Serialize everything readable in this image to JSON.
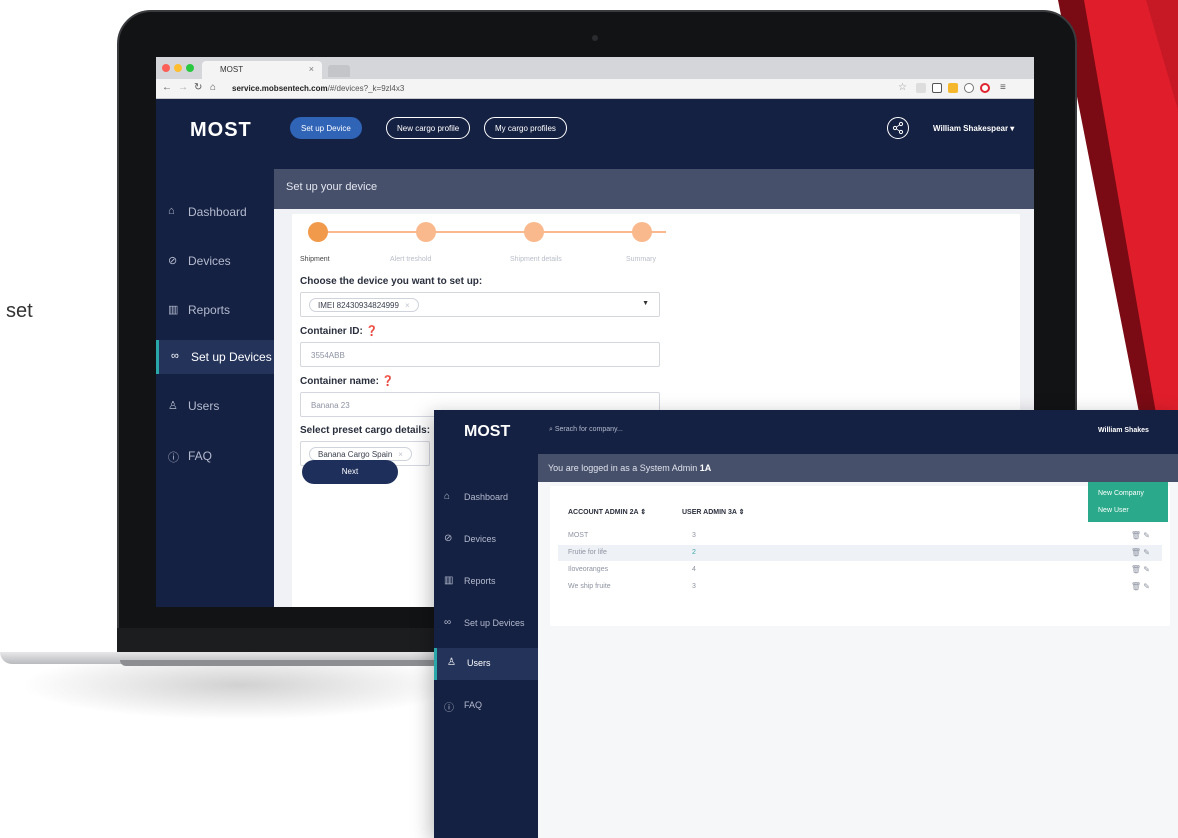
{
  "stray_text": "set",
  "browser": {
    "tab_title": "MOST",
    "tab_close": "×",
    "url_host": "service.mobsentech.com",
    "url_path": "/#/devices?_k=9zl4x3"
  },
  "app": {
    "logo": "MOST",
    "top_buttons": [
      "Set up Device",
      "New cargo profile",
      "My cargo profiles"
    ],
    "user_menu": "William Shakespear ▾",
    "sidebar": [
      "Dashboard",
      "Devices",
      "Reports",
      "Set up Devices",
      "Users",
      "FAQ"
    ],
    "active_sidebar": "Set up Devices",
    "page_title": "Set up your device",
    "steps": [
      "Shipment",
      "Alert treshold",
      "Shipment details",
      "Summary"
    ],
    "device_label": "Choose the device you want to set up:",
    "device_chip": "IMEI 82430934824999",
    "container_id_label": "Container ID:",
    "container_id_value": "3554ABB",
    "container_name_label": "Container name:",
    "container_name_value": "Banana 23",
    "preset_label": "Select preset cargo details:",
    "preset_chip": "Banana Cargo Spain",
    "next_button": "Next"
  },
  "admin": {
    "logo": "MOST",
    "search_placeholder": "Serach for company...",
    "user": "William Shakes",
    "sidebar": [
      "Dashboard",
      "Devices",
      "Reports",
      "Set up Devices",
      "Users",
      "FAQ"
    ],
    "active_sidebar": "Users",
    "logged_in_prefix": "You are logged in as a System Admin",
    "logged_in_level": "1A",
    "menu": [
      "New Company",
      "New User"
    ],
    "columns": [
      "ACCOUNT ADMIN 2A ⇕",
      "USER ADMIN 3A ⇕"
    ],
    "rows": [
      {
        "name": "MOST",
        "count": "3"
      },
      {
        "name": "Frutie for life",
        "count": "2"
      },
      {
        "name": "Iloveoranges",
        "count": "4"
      },
      {
        "name": "We ship fruite",
        "count": "3"
      }
    ]
  },
  "colors": {
    "navy": "#152142",
    "accent_blue": "#2f64b7",
    "orange": "#f29a4b",
    "teal": "#2aaa8a",
    "ribbon_red": "#e01e2b"
  }
}
